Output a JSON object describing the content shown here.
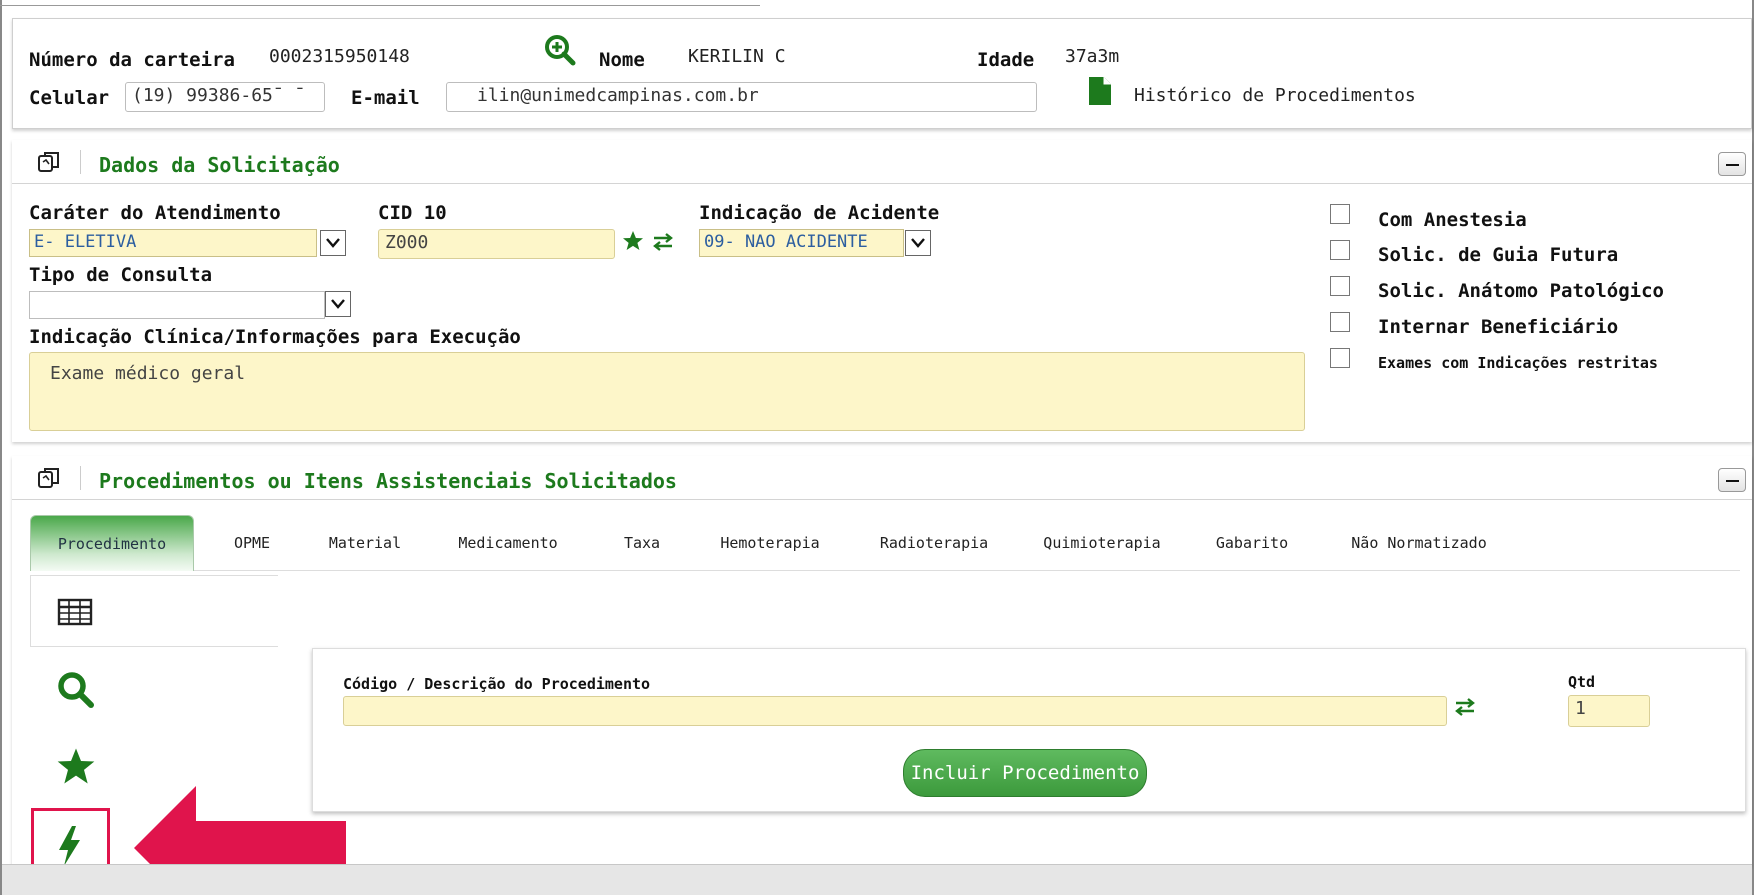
{
  "header": {
    "carteira_label": "Número da carteira",
    "carteira_value": "0002315950148",
    "nome_label": "Nome",
    "nome_value": "KERILIN C",
    "idade_label": "Idade",
    "idade_value": "37a3m",
    "celular_label": "Celular",
    "celular_value": "(19) 99386-65¯ ¯",
    "email_label": "E-mail",
    "email_value": "ilin@unimedcampinas.com.br",
    "historico_label": "Histórico de Procedimentos"
  },
  "dados": {
    "title": "Dados da Solicitação",
    "carater_label": "Caráter do Atendimento",
    "carater_value": "E- ELETIVA",
    "cid_label": "CID 10",
    "cid_value": "Z000",
    "acidente_label": "Indicação de Acidente",
    "acidente_value": "09- NAO ACIDENTE",
    "tipo_label": "Tipo de Consulta",
    "tipo_value": "",
    "indicacao_label": "Indicação Clínica/Informações para Execução",
    "indicacao_value": "Exame médico geral",
    "checkboxes": [
      {
        "label": "Com Anestesia",
        "checked": false
      },
      {
        "label": "Solic. de Guia Futura",
        "checked": false
      },
      {
        "label": "Solic. Anátomo Patológico",
        "checked": false
      },
      {
        "label": "Internar Beneficiário",
        "checked": false
      },
      {
        "label": "Exames com Indicações restritas",
        "checked": false
      }
    ]
  },
  "procedimentos": {
    "title": "Procedimentos ou Itens Assistenciais Solicitados",
    "tabs": [
      {
        "label": "Procedimento",
        "active": true
      },
      {
        "label": "OPME"
      },
      {
        "label": "Material"
      },
      {
        "label": "Medicamento"
      },
      {
        "label": "Taxa"
      },
      {
        "label": "Hemoterapia"
      },
      {
        "label": "Radioterapia"
      },
      {
        "label": "Quimioterapia"
      },
      {
        "label": "Gabarito"
      },
      {
        "label": "Não Normatizado"
      }
    ],
    "codigo_label": "Código / Descrição do Procedimento",
    "codigo_value": "",
    "qtd_label": "Qtd",
    "qtd_value": "1",
    "incluir_label": "Incluir Procedimento"
  },
  "colors": {
    "green": "#1d7a1d",
    "yellow_field": "#fdf6c9",
    "highlight_red": "#e0144c"
  }
}
